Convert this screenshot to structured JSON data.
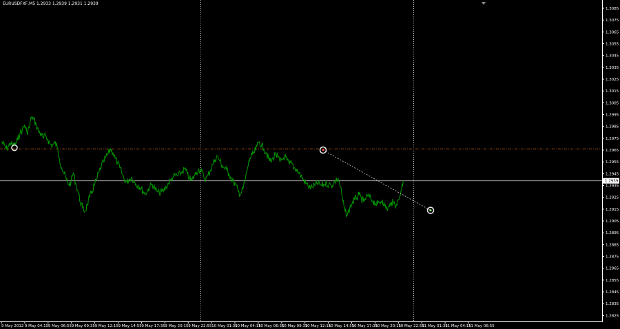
{
  "window": {
    "title": "EURUSDFXF,M5  1.2933 1.2939 1.2931 1.2939"
  },
  "colors": {
    "background": "#000000",
    "price_line": "#009900",
    "axis": "#ffffff",
    "level_line": "#b85a1a",
    "bid_line": "#c0c0c0",
    "separator": "#c8c8c8",
    "trade_link": "#cfcfcf",
    "marker": "#f0f0f0"
  },
  "chart_data": {
    "type": "line",
    "symbol": "EURUSDFXF",
    "timeframe": "M5",
    "ohlc": {
      "open": 1.2933,
      "high": 1.2939,
      "low": 1.2931,
      "close": 1.2939
    },
    "ylim": [
      1.282,
      1.3092
    ],
    "y_ticks": [
      "1.3085",
      "1.3075",
      "1.3065",
      "1.3055",
      "1.3045",
      "1.3035",
      "1.3025",
      "1.3015",
      "1.3005",
      "1.2995",
      "1.2985",
      "1.2975",
      "1.2965",
      "1.2955",
      "1.2945",
      "1.2935",
      "1.2925",
      "1.2915",
      "1.2905",
      "1.2895",
      "1.2885",
      "1.2875",
      "1.2865",
      "1.2855",
      "1.2845",
      "1.2835",
      "1.2825"
    ],
    "x_ticks": [
      "9 May 2012",
      "9 May 04:15",
      "9 May 06:55",
      "9 May 09:35",
      "9 May 12:15",
      "9 May 14:55",
      "9 May 17:35",
      "9 May 20:15",
      "9 May 22:55",
      "10 May 01:35",
      "10 May 04:15",
      "10 May 06:55",
      "10 May 09:35",
      "10 May 12:15",
      "10 May 14:55",
      "10 May 17:35",
      "10 May 20:15",
      "10 May 22:55",
      "11 May 01:35",
      "11 May 04:15",
      "11 May 06:55"
    ],
    "current_price_label": "1.2939",
    "current_price": 1.2939,
    "level_price": 1.2966,
    "x": [
      0,
      1,
      2,
      3,
      4,
      5,
      6,
      7,
      8,
      9,
      10,
      11,
      12,
      13,
      14,
      15,
      16,
      17,
      18,
      19,
      20,
      21,
      22,
      23,
      24,
      25,
      26,
      27,
      28,
      29,
      30,
      31,
      32,
      33,
      34,
      35,
      36,
      37,
      38,
      39,
      40,
      41,
      42,
      43,
      44,
      45,
      46,
      47,
      48,
      49,
      50,
      51,
      52,
      53,
      54,
      55,
      56,
      57,
      58,
      59,
      60,
      61,
      62,
      63,
      64,
      65,
      66,
      67,
      68,
      69,
      70,
      71,
      72,
      73,
      74,
      75,
      76,
      77,
      78,
      79,
      80,
      81,
      82,
      83,
      84,
      85,
      86,
      87,
      88,
      89,
      90,
      91,
      92,
      93,
      94,
      95,
      96,
      97,
      98,
      99,
      100,
      101,
      102,
      103,
      104,
      105,
      106,
      107,
      108,
      109,
      110,
      111,
      112,
      113,
      114,
      115,
      116,
      117,
      118,
      119,
      120,
      121,
      122,
      123,
      124,
      125,
      126,
      127,
      128,
      129,
      130,
      131,
      132,
      133,
      134,
      135,
      136,
      137,
      138,
      139,
      140,
      141,
      142,
      143,
      144,
      145,
      146,
      147,
      148,
      149,
      150,
      151,
      152,
      153,
      154,
      155,
      156,
      157,
      158,
      159,
      160,
      161,
      162,
      163,
      164,
      165,
      166,
      167,
      168,
      169,
      170,
      171,
      172,
      173,
      174,
      175,
      176,
      177,
      178,
      179,
      180,
      181,
      182,
      183,
      184,
      185,
      186,
      187,
      188,
      189,
      190,
      191,
      192,
      193,
      194,
      195,
      196,
      197,
      198,
      199,
      200,
      201,
      202,
      203,
      204,
      205,
      206,
      207,
      208,
      209,
      210
    ],
    "close": [
      1.2972,
      1.297,
      1.2966,
      1.2968,
      1.2971,
      1.2969,
      1.297,
      1.2974,
      1.2979,
      1.2982,
      1.2986,
      1.298,
      1.2984,
      1.2993,
      1.2991,
      1.2986,
      1.2981,
      1.2979,
      1.2975,
      1.2977,
      1.2974,
      1.297,
      1.2969,
      1.2971,
      1.2968,
      1.2958,
      1.295,
      1.2945,
      1.294,
      1.2936,
      1.2938,
      1.2946,
      1.2937,
      1.293,
      1.2921,
      1.2916,
      1.2913,
      1.2919,
      1.2925,
      1.293,
      1.2935,
      1.294,
      1.2946,
      1.2951,
      1.2955,
      1.2959,
      1.2962,
      1.2966,
      1.2963,
      1.2958,
      1.2954,
      1.295,
      1.2945,
      1.294,
      1.2938,
      1.294,
      1.2942,
      1.2939,
      1.2936,
      1.2935,
      1.2933,
      1.293,
      1.2928,
      1.2931,
      1.2934,
      1.2936,
      1.2933,
      1.293,
      1.2929,
      1.293,
      1.2931,
      1.2934,
      1.2937,
      1.294,
      1.2942,
      1.2944,
      1.2943,
      1.2945,
      1.2947,
      1.2949,
      1.2945,
      1.2941,
      1.2939,
      1.2943,
      1.2946,
      1.2949,
      1.2947,
      1.2944,
      1.294,
      1.2944,
      1.2948,
      1.2953,
      1.2957,
      1.296,
      1.2956,
      1.2952,
      1.295,
      1.2948,
      1.2945,
      1.2941,
      1.2938,
      1.2935,
      1.293,
      1.2928,
      1.2932,
      1.294,
      1.295,
      1.2958,
      1.2961,
      1.2963,
      1.2968,
      1.2972,
      1.2969,
      1.2966,
      1.2963,
      1.2958,
      1.2955,
      1.2958,
      1.2962,
      1.2959,
      1.2955,
      1.2957,
      1.296,
      1.2956,
      1.2953,
      1.2954,
      1.295,
      1.2949,
      1.2946,
      1.2943,
      1.294,
      1.2937,
      1.2935,
      1.2933,
      1.2934,
      1.2935,
      1.2937,
      1.2936,
      1.2935,
      1.2936,
      1.2937,
      1.2936,
      1.2935,
      1.2937,
      1.2939,
      1.2941,
      1.2934,
      1.2922,
      1.2913,
      1.291,
      1.2916,
      1.292,
      1.2923,
      1.2925,
      1.2927,
      1.2924,
      1.2921,
      1.2925,
      1.2926,
      1.2924,
      1.2922,
      1.292,
      1.2919,
      1.2921,
      1.2923,
      1.2918,
      1.2915,
      1.2917,
      1.2921,
      1.292,
      1.2919,
      1.2923,
      1.293,
      1.2939
    ]
  }
}
